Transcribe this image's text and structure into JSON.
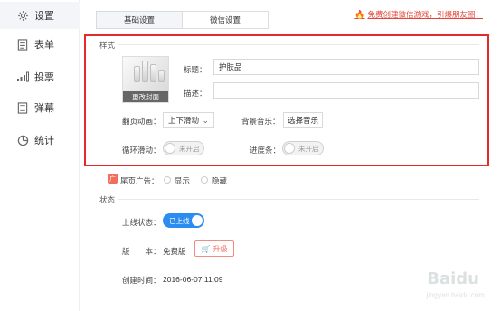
{
  "sidebar": {
    "items": [
      {
        "label": "设置",
        "icon": "gear-icon"
      },
      {
        "label": "表单",
        "icon": "form-icon"
      },
      {
        "label": "投票",
        "icon": "bar-chart-icon"
      },
      {
        "label": "弹幕",
        "icon": "barrage-icon"
      },
      {
        "label": "统计",
        "icon": "pie-chart-icon"
      }
    ]
  },
  "tabs": [
    {
      "label": "基础设置"
    },
    {
      "label": "微信设置"
    }
  ],
  "promo": {
    "text": "免费创建微信游戏，引爆朋友圈！"
  },
  "style_section": {
    "title": "样式",
    "cover_button": "更改封面",
    "title_label": "标题：",
    "title_value": "护肤品",
    "desc_label": "描述：",
    "desc_value": "",
    "flip_anim_label": "翻页动画：",
    "flip_anim_value": "上下滑动",
    "bgm_label": "背景音乐：",
    "bgm_button": "选择音乐",
    "loop_label": "循环滑动：",
    "loop_toggle": "未开启",
    "progress_label": "进度条：",
    "progress_toggle": "未开启"
  },
  "ad": {
    "icon": "广",
    "label": "尾页广告：",
    "show": "显示",
    "hide": "隐藏"
  },
  "status_section": {
    "title": "状态",
    "online_label": "上线状态：",
    "online_toggle": "已上线",
    "version_label": "版　　本：",
    "version_value": "免费版",
    "upgrade_button": "升级",
    "created_label": "创建时间：",
    "created_value": "2016-06-07 11:09"
  },
  "watermark": {
    "line1": "Baidu",
    "line2": "jingyan.baidu.com"
  },
  "colors": {
    "accent": "#2d8cf0",
    "highlight": "#e3292a",
    "promo": "#e0463a"
  }
}
